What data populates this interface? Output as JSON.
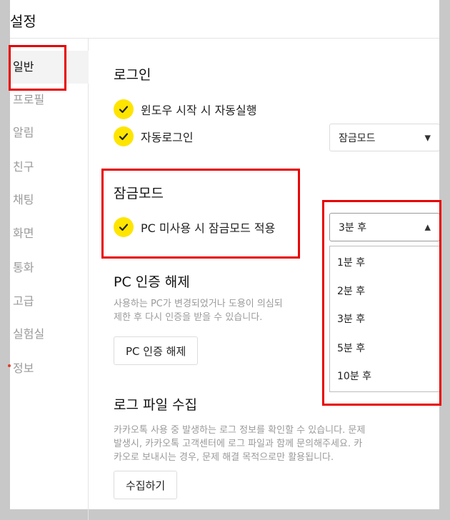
{
  "window": {
    "title": "설정"
  },
  "sidebar": {
    "items": [
      "일반",
      "프로필",
      "알림",
      "친구",
      "채팅",
      "화면",
      "통화",
      "고급",
      "실험실",
      "정보"
    ]
  },
  "login": {
    "title": "로그인",
    "startup_label": "윈도우 시작 시 자동실행",
    "autologin_label": "자동로그인",
    "autologin_select_value": "잠금모드"
  },
  "lockmode": {
    "title": "잠금모드",
    "idle_label": "PC 미사용 시 잠금모드 적용",
    "idle_select_value": "3분 후",
    "options": [
      "1분 후",
      "2분 후",
      "3분 후",
      "5분 후",
      "10분 후"
    ]
  },
  "pc_auth": {
    "title": "PC 인증 해제",
    "desc_line1": "사용하는 PC가 변경되었거나 도용이 의심되",
    "desc_line2": "제한 후 다시 인증을 받을 수 있습니다.",
    "button": "PC 인증 해제"
  },
  "log": {
    "title": "로그 파일 수집",
    "desc_line1": "카카오톡 사용 중 발생하는 로그 정보를 확인할 수 있습니다. 문제",
    "desc_line2": "발생시, 카카오톡 고객센터에 로그 파일과 함께 문의해주세요. 카",
    "desc_line3": "카오로 보내시는 경우, 문제 해결 목적으로만 활용됩니다.",
    "button": "수집하기"
  },
  "colors": {
    "accent": "#fee500",
    "highlight": "#e80000"
  },
  "icons": {
    "check": "checkmark-icon",
    "caret_down": "caret-down-icon",
    "caret_up": "caret-up-icon"
  }
}
